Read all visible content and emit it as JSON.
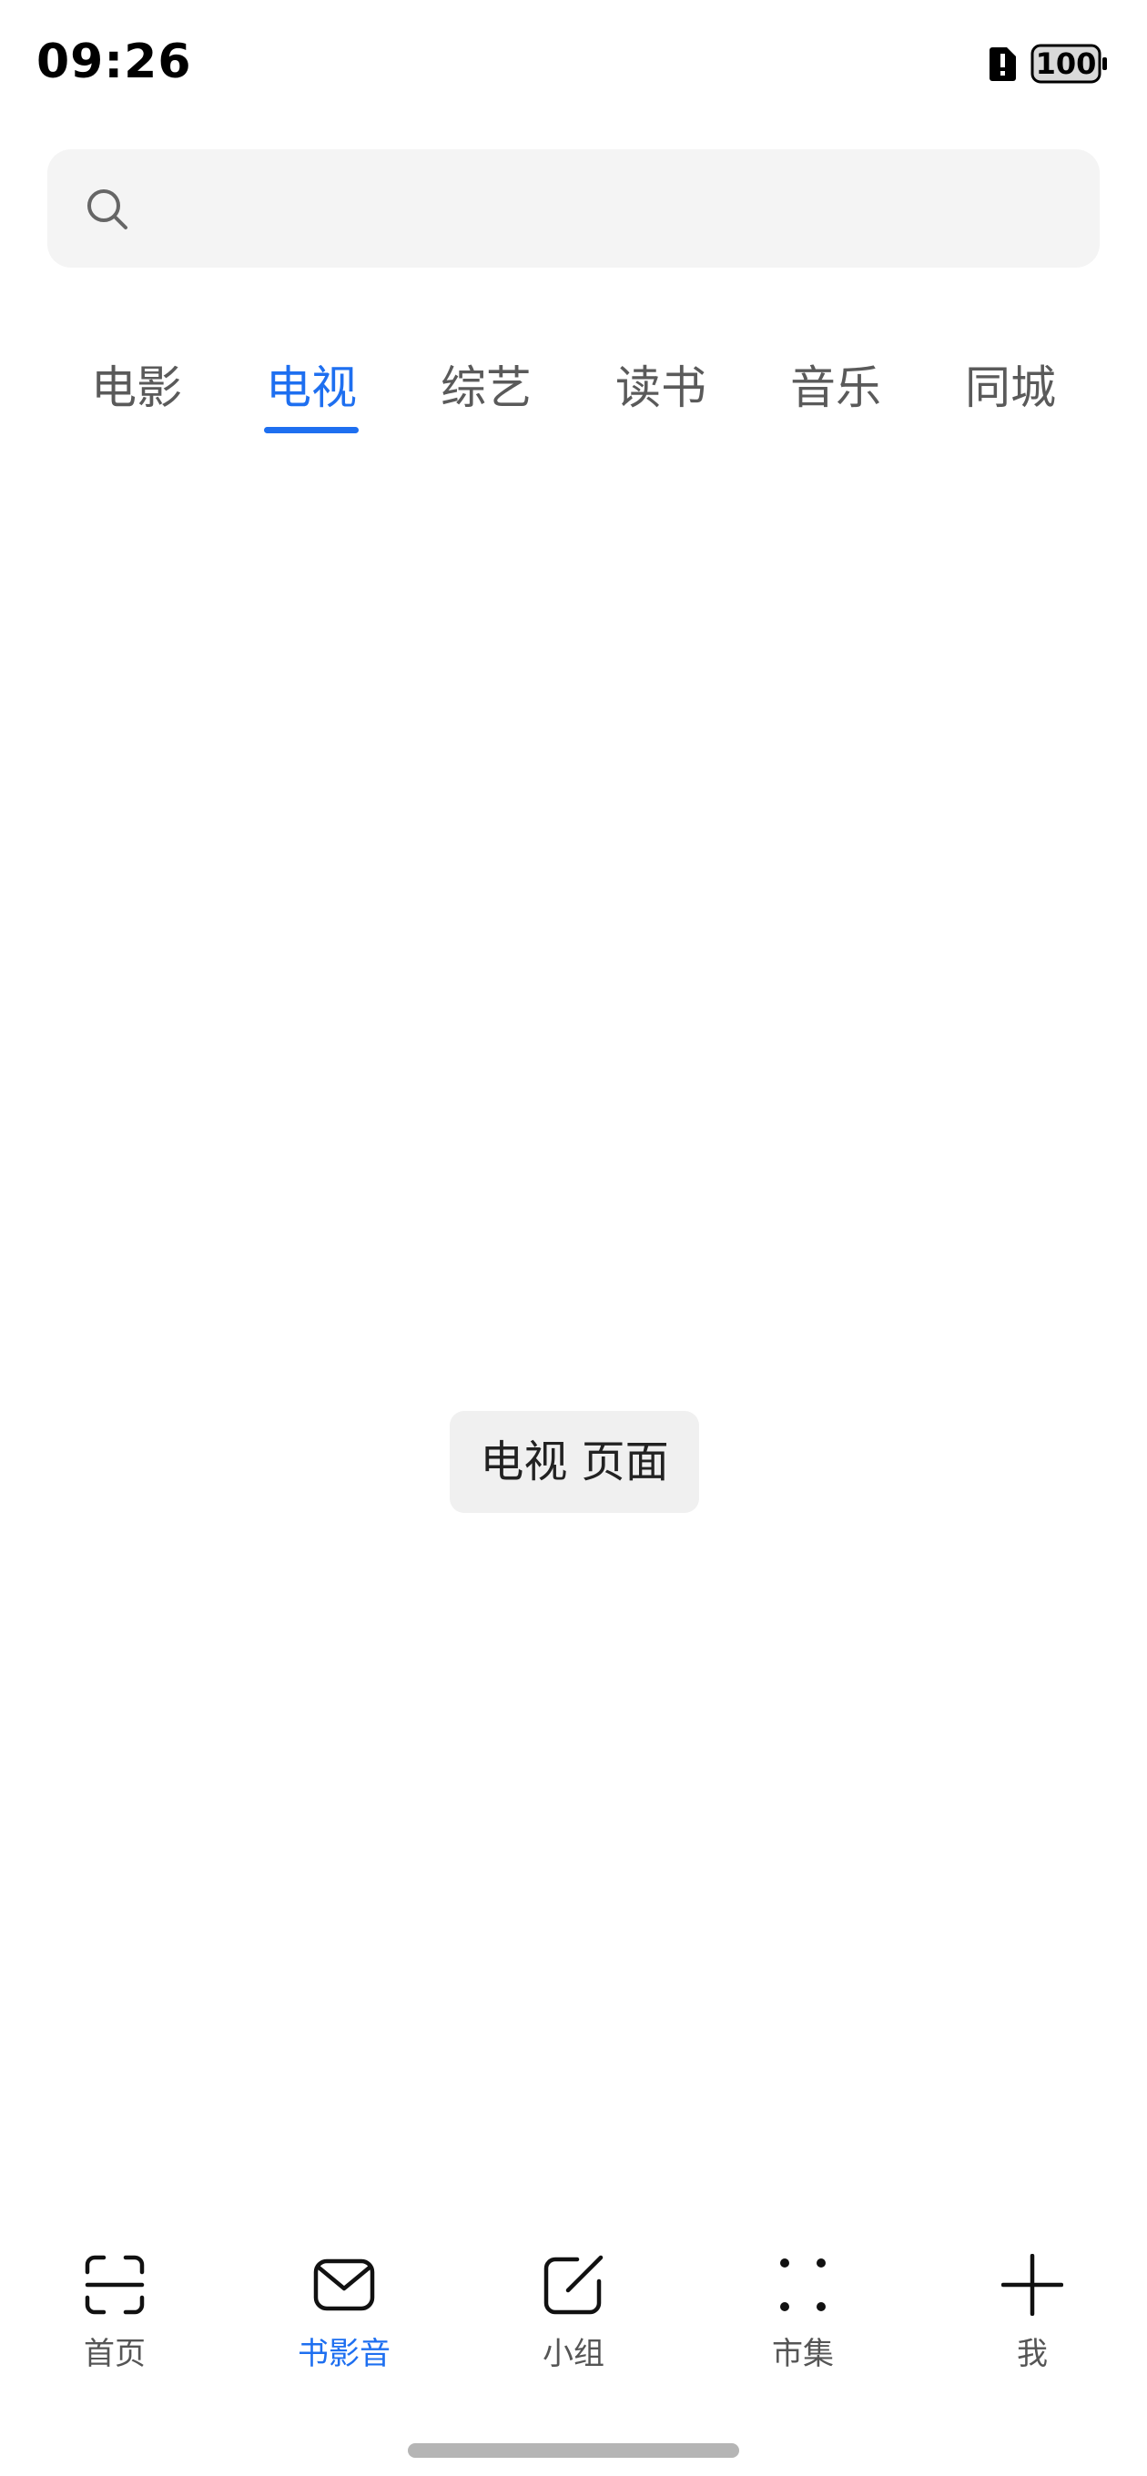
{
  "status_bar": {
    "time": "09:26",
    "battery": "100",
    "alert_icon": "sim-alert-icon",
    "battery_icon": "battery-icon"
  },
  "search": {
    "icon": "search-icon",
    "value": "",
    "placeholder": ""
  },
  "tabs": [
    {
      "label": "电影",
      "active": false
    },
    {
      "label": "电视",
      "active": true
    },
    {
      "label": "综艺",
      "active": false
    },
    {
      "label": "读书",
      "active": false
    },
    {
      "label": "音乐",
      "active": false
    },
    {
      "label": "同城",
      "active": false
    }
  ],
  "main": {
    "placeholder_text": "电视 页面"
  },
  "bottom_nav": [
    {
      "label": "首页",
      "icon": "scan-icon",
      "active": false
    },
    {
      "label": "书影音",
      "icon": "mail-icon",
      "active": true
    },
    {
      "label": "小组",
      "icon": "edit-icon",
      "active": false
    },
    {
      "label": "市集",
      "icon": "dots-grid-icon",
      "active": false
    },
    {
      "label": "我",
      "icon": "plus-icon",
      "active": false
    }
  ],
  "colors": {
    "accent": "#1e6ff0",
    "tab_inactive": "#5a5a5a",
    "search_bg": "#f4f4f4",
    "nav_label": "#555555"
  }
}
